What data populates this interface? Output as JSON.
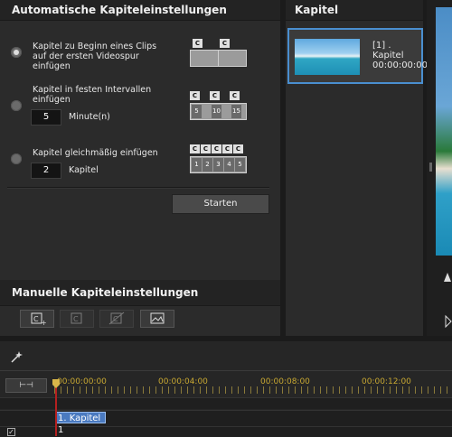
{
  "auto_panel": {
    "title": "Automatische Kapiteleinstellungen",
    "options": [
      {
        "label_lines": [
          "Kapitel zu Beginn eines Clips",
          "auf der ersten Videospur",
          "einfügen"
        ],
        "selected": true
      },
      {
        "label_lines": [
          "Kapitel in festen Intervallen",
          "einfügen"
        ],
        "selected": false,
        "value": "5",
        "unit": "Minute(n)"
      },
      {
        "label_lines": [
          "Kapitel gleichmäßig einfügen"
        ],
        "selected": false,
        "value": "2",
        "unit": "Kapitel"
      }
    ],
    "diagram_interval_cells": [
      "5",
      "10",
      "15"
    ],
    "diagram_even_cells": [
      "1",
      "2",
      "3",
      "4",
      "5"
    ],
    "marker_letter": "C",
    "start_label": "Starten"
  },
  "manual_panel": {
    "title": "Manuelle Kapiteleinstellungen",
    "tools": [
      "add-chapter-icon",
      "remove-chapter-icon",
      "remove-all-chapters-icon",
      "set-thumbnail-icon"
    ]
  },
  "chapter_panel": {
    "title": "Kapitel",
    "items": [
      {
        "name": "[1] . Kapitel",
        "time": "00:00:00:00"
      }
    ]
  },
  "timeline": {
    "timestamps": [
      "00:00:00:00",
      "00:00:04:00",
      "00:00:08:00",
      "00:00:12:00"
    ],
    "chapter_marker": "1. Kapitel 1"
  },
  "colors": {
    "accent": "#4a8fd0",
    "playhead": "#b42020",
    "timecode": "#c8a832"
  }
}
